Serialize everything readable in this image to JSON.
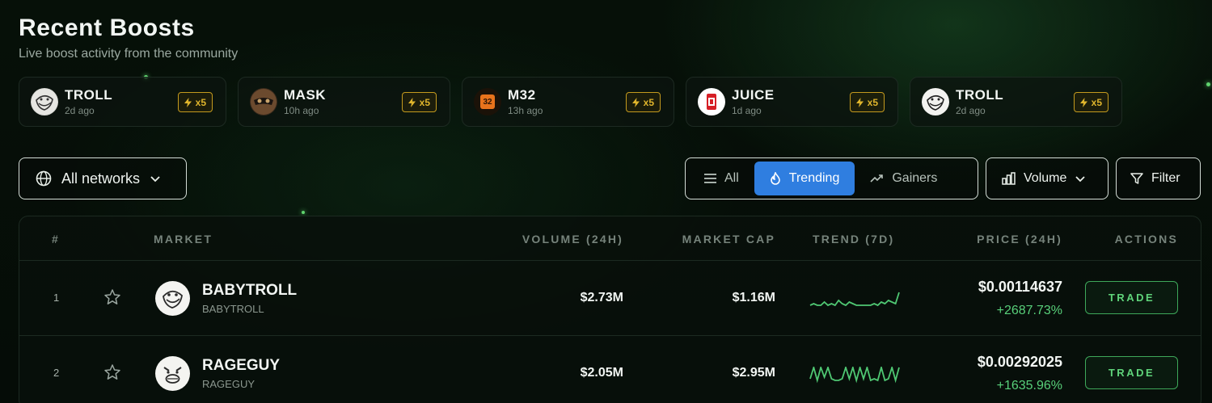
{
  "header": {
    "title": "Recent Boosts",
    "subtitle": "Live boost activity from the community"
  },
  "boosts": [
    {
      "symbol": "TROLL",
      "time": "2d ago",
      "multiplier": "x5",
      "icon": "troll-face-icon"
    },
    {
      "symbol": "MASK",
      "time": "10h ago",
      "multiplier": "x5",
      "icon": "mask-icon"
    },
    {
      "symbol": "M32",
      "time": "13h ago",
      "multiplier": "x5",
      "icon": "m32-icon",
      "icon_text": "32"
    },
    {
      "symbol": "JUICE",
      "time": "1d ago",
      "multiplier": "x5",
      "icon": "juice-can-icon"
    },
    {
      "symbol": "TROLL",
      "time": "2d ago",
      "multiplier": "x5",
      "icon": "troll-face-icon"
    }
  ],
  "controls": {
    "networks_label": "All networks",
    "tabs": [
      {
        "label": "All",
        "icon": "list-icon",
        "active": false
      },
      {
        "label": "Trending",
        "icon": "flame-icon",
        "active": true
      },
      {
        "label": "Gainers",
        "icon": "trending-up-icon",
        "active": false
      }
    ],
    "sort_label": "Volume",
    "filter_label": "Filter"
  },
  "table": {
    "columns": [
      "#",
      "MARKET",
      "VOLUME (24H)",
      "MARKET CAP",
      "TREND (7D)",
      "PRICE (24H)",
      "ACTIONS"
    ],
    "rows": [
      {
        "rank": "1",
        "name": "BABYTROLL",
        "symbol": "BABYTROLL",
        "volume": "$2.73M",
        "market_cap": "$1.16M",
        "price": "$0.00114637",
        "change": "+2687.73%",
        "action": "TRADE",
        "trend": [
          2,
          3,
          2,
          2,
          4,
          2,
          3,
          2,
          5,
          3,
          2,
          4,
          3,
          2,
          2,
          2,
          2,
          2,
          3,
          2,
          4,
          3,
          5,
          4,
          3,
          10
        ]
      },
      {
        "rank": "2",
        "name": "RAGEGUY",
        "symbol": "RAGEGUY",
        "volume": "$2.05M",
        "market_cap": "$2.95M",
        "price": "$0.00292025",
        "change": "+1635.96%",
        "action": "TRADE",
        "trend": [
          3,
          10,
          2,
          10,
          4,
          10,
          3,
          2,
          2,
          3,
          10,
          3,
          10,
          2,
          10,
          3,
          10,
          2,
          3,
          2,
          10,
          2,
          3,
          10,
          2,
          10
        ]
      }
    ]
  },
  "colors": {
    "accent_blue": "#2f7ee0",
    "positive_green": "#58d07a",
    "boost_gold": "#e0b52c"
  }
}
